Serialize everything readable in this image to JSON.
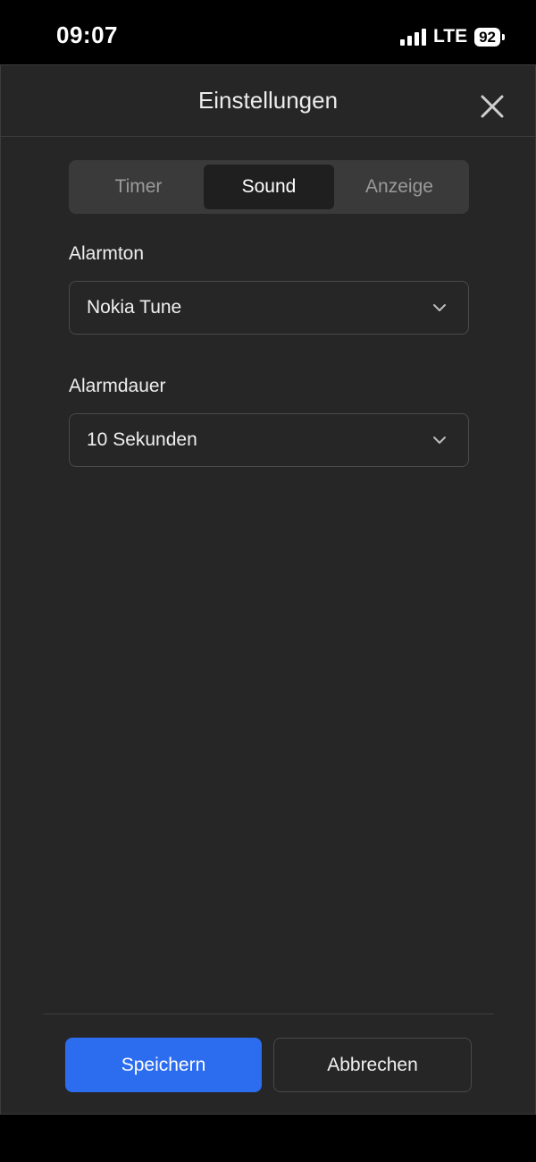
{
  "status_bar": {
    "time": "09:07",
    "network": "LTE",
    "battery": "92"
  },
  "dialog": {
    "title": "Einstellungen",
    "close_icon": "close-icon"
  },
  "tabs": [
    {
      "label": "Timer",
      "active": false
    },
    {
      "label": "Sound",
      "active": true
    },
    {
      "label": "Anzeige",
      "active": false
    }
  ],
  "sound": {
    "alarm_tone": {
      "label": "Alarmton",
      "value": "Nokia Tune"
    },
    "alarm_duration": {
      "label": "Alarmdauer",
      "value": "10 Sekunden"
    }
  },
  "footer": {
    "save_label": "Speichern",
    "cancel_label": "Abbrechen"
  },
  "colors": {
    "accent": "#2c6cef",
    "surface": "#262626",
    "segment_bg": "#3a3a3a"
  }
}
